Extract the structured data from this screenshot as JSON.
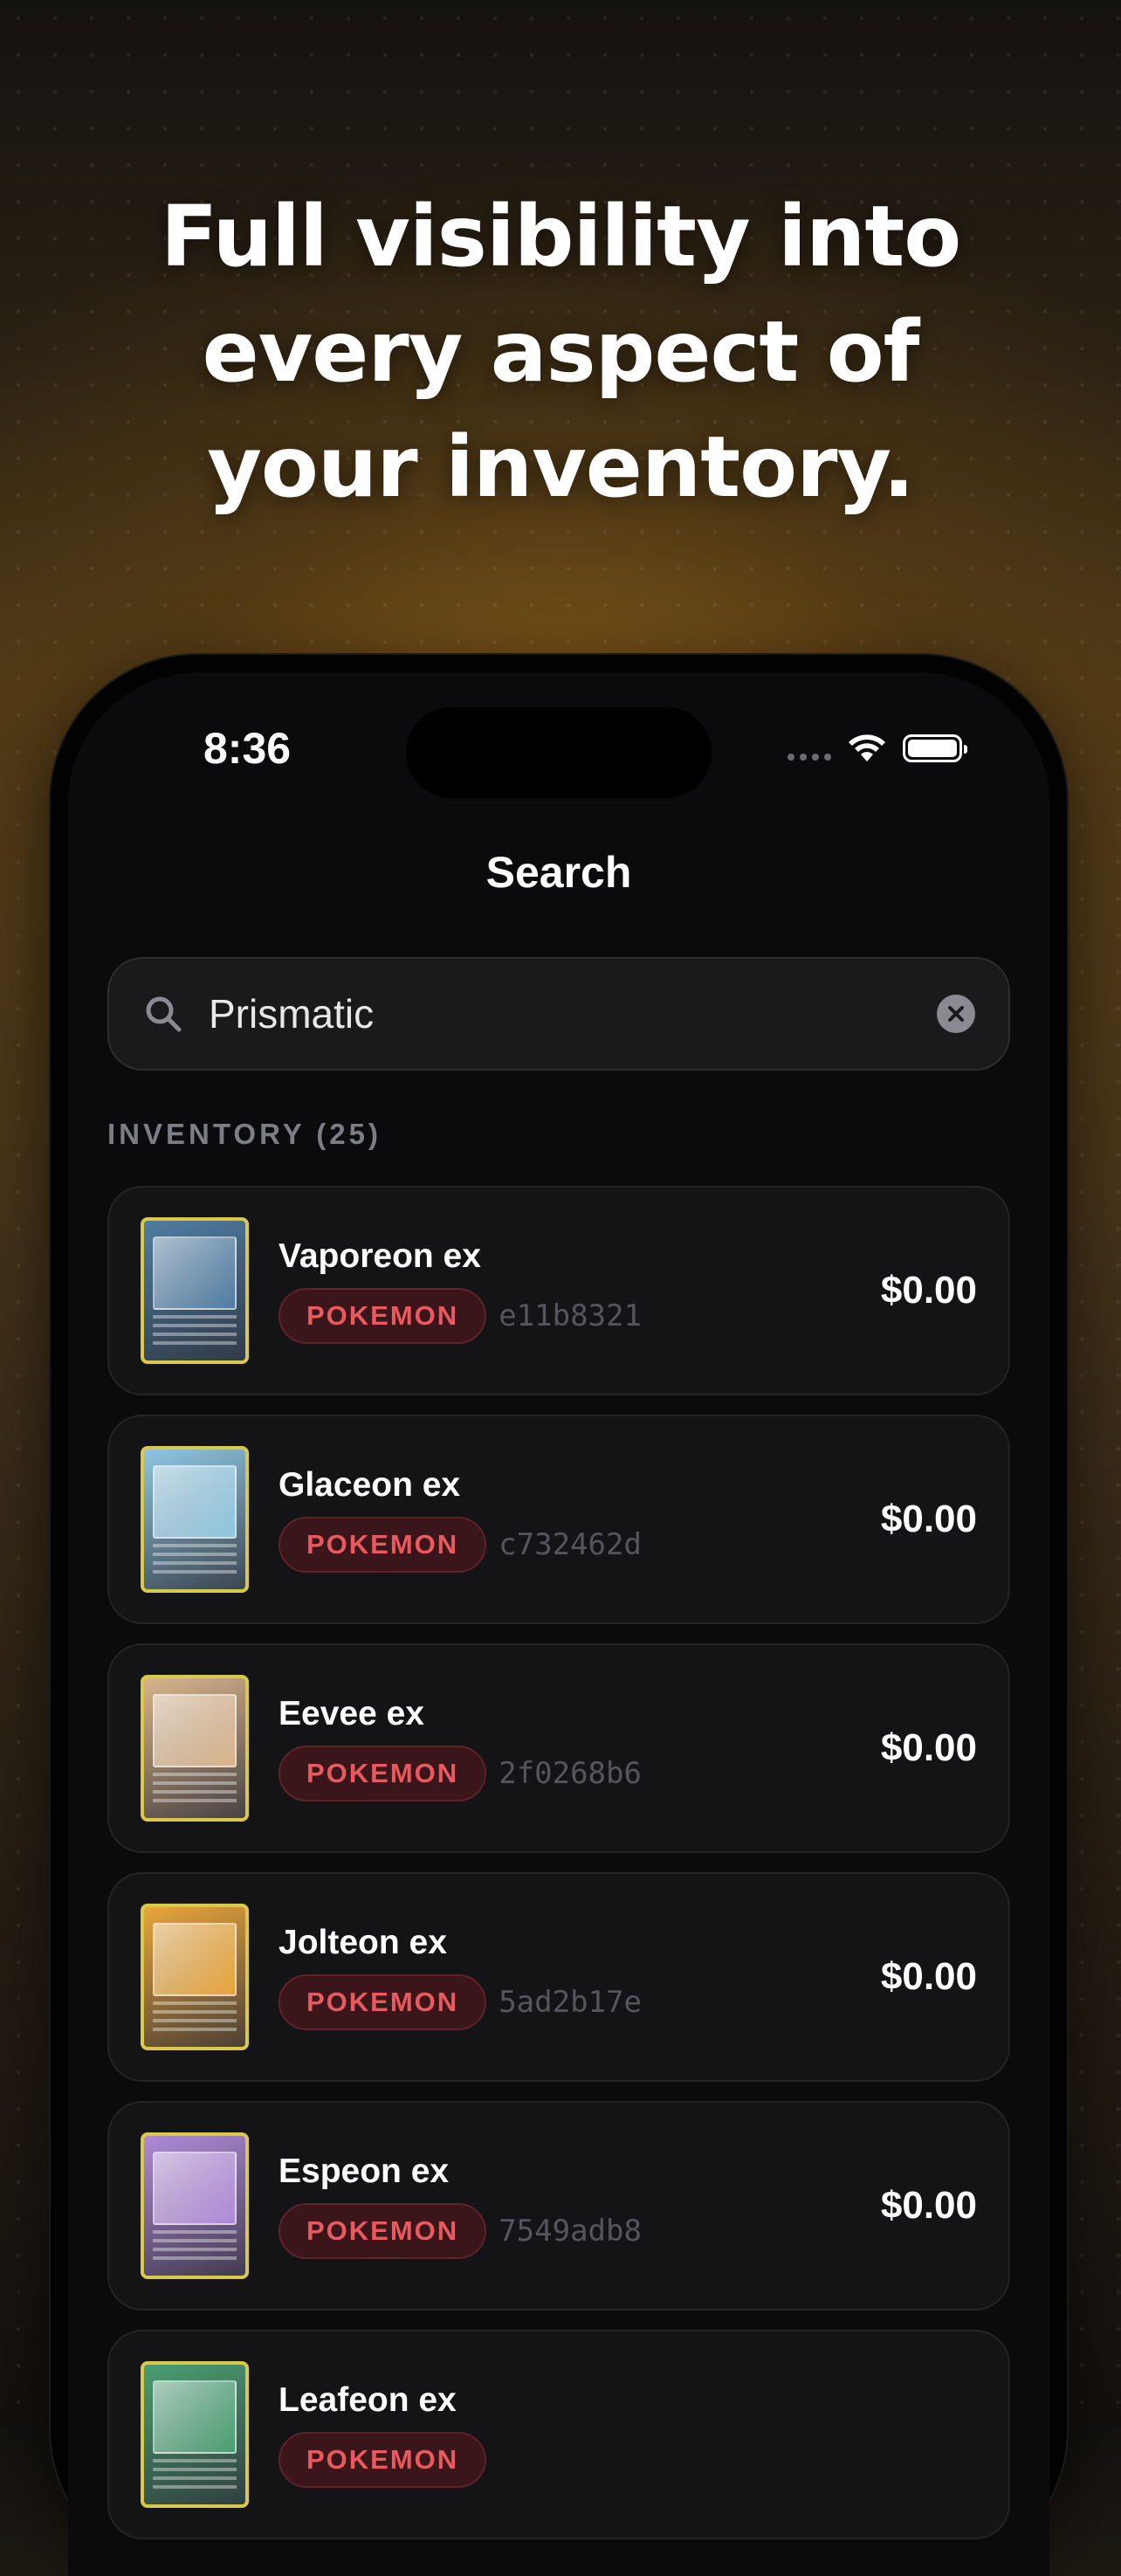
{
  "headline": [
    "Full visibility into",
    "every aspect of",
    "your inventory."
  ],
  "status_bar": {
    "time": "8:36"
  },
  "nav": {
    "title": "Search"
  },
  "search": {
    "value": "Prismatic",
    "placeholder": "Search"
  },
  "section": {
    "header": "INVENTORY (25)"
  },
  "items": [
    {
      "name": "Vaporeon ex",
      "tag": "POKEMON",
      "code": "e11b8321",
      "price": "$0.00",
      "art_color": "#4f7da3"
    },
    {
      "name": "Glaceon ex",
      "tag": "POKEMON",
      "code": "c732462d",
      "price": "$0.00",
      "art_color": "#8fc6e0"
    },
    {
      "name": "Eevee ex",
      "tag": "POKEMON",
      "code": "2f0268b6",
      "price": "$0.00",
      "art_color": "#d9b48c"
    },
    {
      "name": "Jolteon ex",
      "tag": "POKEMON",
      "code": "5ad2b17e",
      "price": "$0.00",
      "art_color": "#e8a53a"
    },
    {
      "name": "Espeon ex",
      "tag": "POKEMON",
      "code": "7549adb8",
      "price": "$0.00",
      "art_color": "#b08ad8"
    },
    {
      "name": "Leafeon ex",
      "tag": "POKEMON",
      "code": "",
      "price": "",
      "art_color": "#4a9e72"
    }
  ],
  "colors": {
    "tag_text": "#e85a5f",
    "tag_bg": "#3a1519",
    "background_accent": "#6b4a16"
  }
}
